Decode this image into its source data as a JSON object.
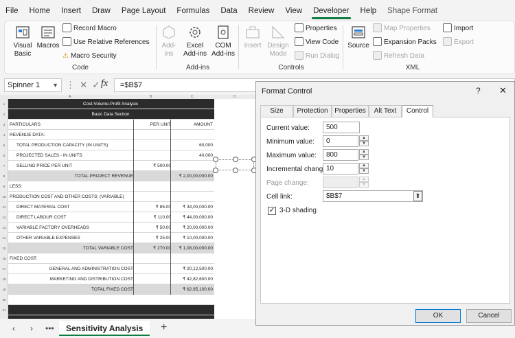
{
  "menu": [
    "File",
    "Home",
    "Insert",
    "Draw",
    "Page Layout",
    "Formulas",
    "Data",
    "Review",
    "View",
    "Developer",
    "Help",
    "Shape Format"
  ],
  "ribbon": {
    "code": {
      "label": "Code",
      "visual_basic": "Visual Basic",
      "macros": "Macros",
      "record_macro": "Record Macro",
      "relative_refs": "Use Relative References",
      "macro_security": "Macro Security"
    },
    "addins": {
      "label": "Add-ins",
      "addins": "Add-ins",
      "excel_addins": "Excel Add-ins",
      "com_addins": "COM Add-ins"
    },
    "controls": {
      "label": "Controls",
      "insert": "Insert",
      "design_mode": "Design Mode",
      "properties": "Properties",
      "view_code": "View Code",
      "run_dialog": "Run Dialog"
    },
    "xml": {
      "label": "XML",
      "source": "Source",
      "map_properties": "Map Properties",
      "expansion_packs": "Expansion Packs",
      "refresh_data": "Refresh Data",
      "import": "Import",
      "export": "Export"
    }
  },
  "formula_bar": {
    "name_box": "Spinner 1",
    "fx": "fx",
    "formula": "=$B$7"
  },
  "sheet": {
    "col_headers": [
      "A",
      "B",
      "C",
      "D"
    ],
    "title": "Cost-Volume-Profit Analysis",
    "subtitle": "Basic Data Section",
    "header": [
      "PARTICULARS",
      "PER UNIT",
      "AMOUNT"
    ],
    "rows": [
      [
        "REVENUE DATA:",
        "",
        ""
      ],
      [
        "TOTAL PRODUCTION CAPACITY (IN UNITS)",
        "",
        "60,000"
      ],
      [
        "PROJECTED SALES - IN UNITS",
        "",
        "40,000"
      ],
      [
        "SELLING PRICE PER UNIT",
        "₹ 500.00",
        ""
      ],
      [
        "TOTAL PROJECT REVENUE",
        "",
        "₹ 2,00,00,000.00"
      ],
      [
        "LESS:",
        "",
        ""
      ],
      [
        "PRODUCTION COST AND OTHER COSTS: (VARIABLE)",
        "",
        ""
      ],
      [
        "DIRECT MATERIAL COST",
        "₹ 85.00",
        "₹ 34,00,000.00"
      ],
      [
        "DIRECT LABOUR COST",
        "₹ 110.00",
        "₹ 44,00,000.00"
      ],
      [
        "VARIABLE FACTORY OVERHEADS",
        "₹ 50.00",
        "₹ 20,00,000.00"
      ],
      [
        "OTHER VARIABLE EXPENSES",
        "₹ 25.00",
        "₹ 10,00,000.00"
      ],
      [
        "TOTAL VARIABLE COST",
        "₹ 270.00",
        "₹ 1,08,00,000.00"
      ],
      [
        "FIXED COST:",
        "",
        ""
      ],
      [
        "GENERAL AND ADMINISTRATION COST",
        "",
        "₹ 20,12,500.00"
      ],
      [
        "MARKETING AND DISTRIBUTION COST",
        "",
        "₹ 42,82,600.00"
      ],
      [
        "TOTAL FIXED COST",
        "",
        "₹ 62,95,100.00"
      ]
    ],
    "row_numbers": [
      "1",
      "2",
      "3",
      "4",
      "5",
      "6",
      "7",
      "8",
      "9",
      "10",
      "11",
      "12",
      "13",
      "14",
      "15",
      "16",
      "17",
      "18",
      "19",
      "20",
      "21"
    ]
  },
  "tabs": {
    "sheet_name": "Sensitivity Analysis",
    "add": "+"
  },
  "dialog": {
    "title": "Format Control",
    "tabs": [
      "Size",
      "Protection",
      "Properties",
      "Alt Text",
      "Control"
    ],
    "active_tab": "Control",
    "fields": {
      "current_value": {
        "label": "Current value:",
        "value": "500"
      },
      "minimum_value": {
        "label": "Minimum value:",
        "value": "0"
      },
      "maximum_value": {
        "label": "Maximum value:",
        "value": "800"
      },
      "incremental_change": {
        "label": "Incremental change:",
        "value": "10"
      },
      "page_change": {
        "label": "Page change:",
        "value": ""
      },
      "cell_link": {
        "label": "Cell link:",
        "value": "$B$7"
      }
    },
    "shading": {
      "label": "3-D shading",
      "checked": true
    },
    "ok": "OK",
    "cancel": "Cancel"
  }
}
